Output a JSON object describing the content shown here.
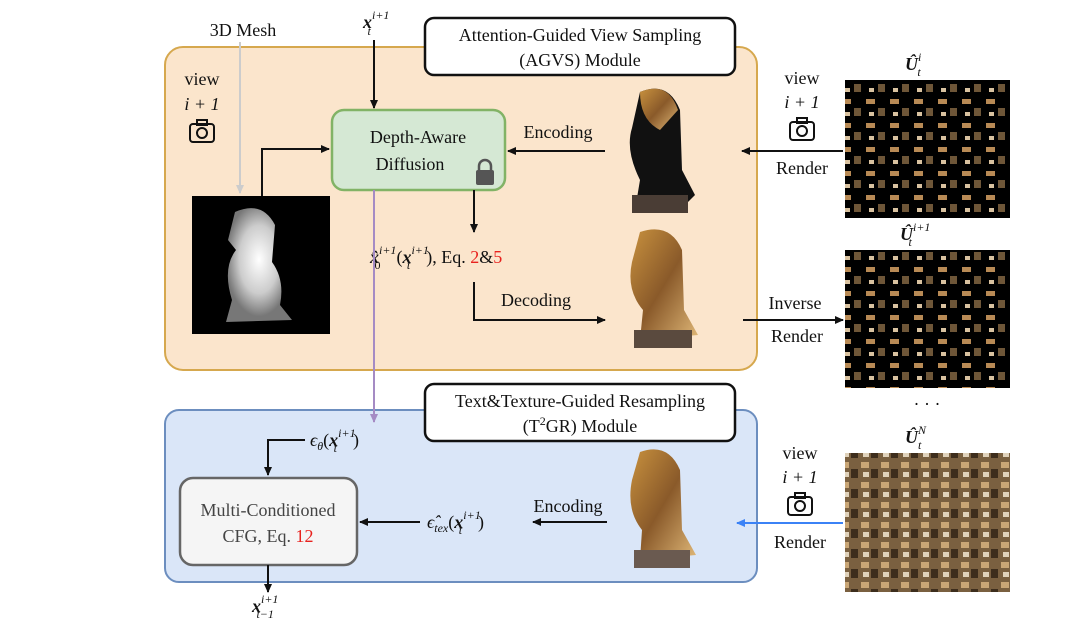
{
  "colors": {
    "agvs_fill": "#fbe5cc",
    "agvs_stroke": "#d6a84e",
    "t2gr_fill": "#dae6f8",
    "t2gr_stroke": "#6c8ebf",
    "diffusion_fill": "#d5e8d4",
    "diffusion_stroke": "#82b366",
    "cfg_fill": "#f5f5f5",
    "cfg_stroke": "#666666",
    "eq_ref": "#e8221e",
    "purple_arrow": "#a58bc4",
    "blue_arrow": "#3b82f6",
    "mesh_arrow": "#cccccc"
  },
  "labels": {
    "mesh": "3D Mesh",
    "x_input": {
      "base": "x",
      "sub": "t",
      "sup": "i+1"
    },
    "agvs_title_1": "Attention-Guided View Sampling",
    "agvs_title_2": "(AGVS) Module",
    "view_left": {
      "line1": "view",
      "line2": "i + 1",
      "icon": "camera-icon"
    },
    "diffusion_1": "Depth-Aware",
    "diffusion_2": "Diffusion",
    "lock_icon": "lock-icon",
    "encoding_top": "Encoding",
    "x0_hat": {
      "base": "x̂",
      "sub": "0",
      "sup": "i+1",
      "arg_base": "x",
      "arg_sub": "t",
      "arg_sup": "i+1",
      "suffix": "), Eq. ",
      "eq1": "2",
      "amp": "&",
      "eq2": "5"
    },
    "decoding": "Decoding",
    "view_right_top": {
      "line1": "view",
      "line2": "i + 1",
      "icon": "camera-icon",
      "action": "Render"
    },
    "inverse_render_1": "Inverse",
    "inverse_render_2": "Render",
    "U_i": {
      "base": "Û",
      "sub": "t",
      "sup": "i"
    },
    "U_i1": {
      "base": "Û",
      "sub": "t",
      "sup": "i+1"
    },
    "ellipsis": "· · ·",
    "U_N": {
      "base": "Û",
      "sub": "t",
      "sup": "N"
    },
    "t2gr_title_1": "Text&Texture-Guided Resampling",
    "t2gr_title_2a": "(T",
    "t2gr_title_2sup": "2",
    "t2gr_title_2b": "GR) Module",
    "eps_theta": {
      "base": "ϵ",
      "sub": "θ",
      "arg_base": "x",
      "arg_sub": "t",
      "arg_sup": "i+1"
    },
    "cfg_1": "Multi-Conditioned",
    "cfg_2": "CFG, Eq. ",
    "cfg_eq": "12",
    "encoding_bottom": "Encoding",
    "eps_tex": {
      "base": "ϵ̂",
      "sub": "tex",
      "arg_base": "x",
      "arg_sub": "t",
      "arg_sup": "i+1"
    },
    "view_right_bottom": {
      "line1": "view",
      "line2": "i + 1",
      "icon": "camera-icon",
      "action": "Render"
    },
    "x_output": {
      "base": "x",
      "sub": "t−1",
      "sup": "i+1"
    }
  }
}
